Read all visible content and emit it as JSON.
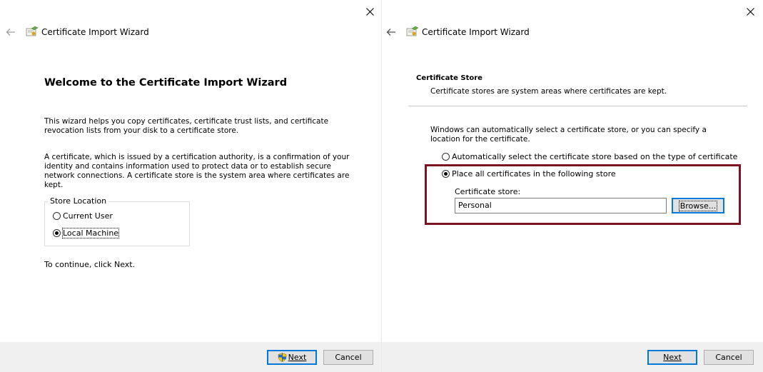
{
  "left": {
    "title": "Certificate Import Wizard",
    "heading": "Welcome to the Certificate Import Wizard",
    "para1": "This wizard helps you copy certificates, certificate trust lists, and certificate revocation lists from your disk to a certificate store.",
    "para2": "A certificate, which is issued by a certification authority, is a confirmation of your identity and contains information used to protect data or to establish secure network connections. A certificate store is the system area where certificates are kept.",
    "store_location": {
      "legend": "Store Location",
      "options": [
        {
          "label": "Current User",
          "checked": false
        },
        {
          "label": "Local Machine",
          "checked": true
        }
      ]
    },
    "continue_text": "To continue, click Next.",
    "next_label": "Next",
    "cancel_label": "Cancel"
  },
  "right": {
    "title": "Certificate Import Wizard",
    "section_title": "Certificate Store",
    "section_desc": "Certificate stores are system areas where certificates are kept.",
    "intro": "Windows can automatically select a certificate store, or you can specify a location for the certificate.",
    "options": [
      {
        "label": "Automatically select the certificate store based on the type of certificate",
        "checked": false
      },
      {
        "label": "Place all certificates in the following store",
        "checked": true
      }
    ],
    "store_label": "Certificate store:",
    "store_value": "Personal",
    "browse_label": "Browse...",
    "next_label": "Next",
    "cancel_label": "Cancel"
  },
  "colors": {
    "highlight": "#7a1420",
    "default_button_border": "#0078d7",
    "footer_bg": "#f0f0f0"
  },
  "icons": [
    "close-icon",
    "back-arrow-icon",
    "certificate-icon",
    "uac-shield-icon"
  ]
}
